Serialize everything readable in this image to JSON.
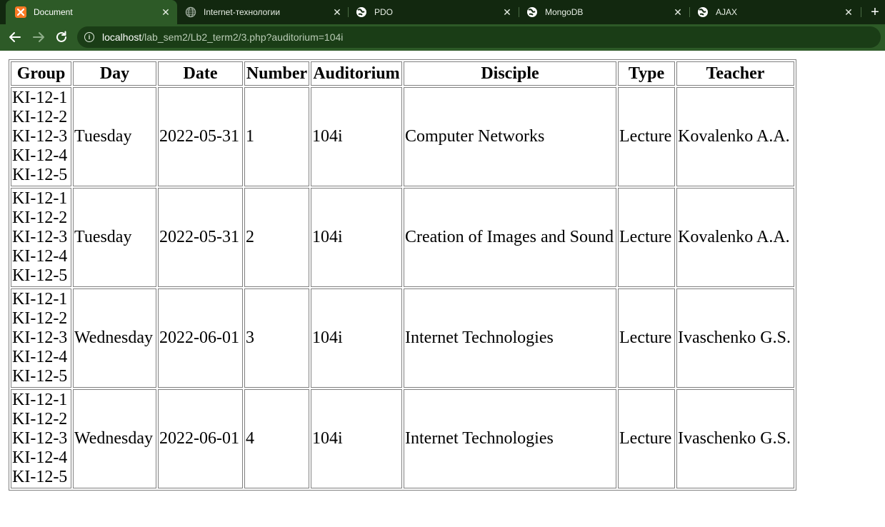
{
  "browser": {
    "tabs": [
      {
        "title": "Document",
        "icon": "xampp-icon",
        "active": true
      },
      {
        "title": "Internet-технологии",
        "icon": "globe-icon",
        "active": false
      },
      {
        "title": "PDO",
        "icon": "web-icon",
        "active": false
      },
      {
        "title": "MongoDB",
        "icon": "web-icon",
        "active": false
      },
      {
        "title": "AJAX",
        "icon": "web-icon",
        "active": false
      }
    ],
    "close_glyph": "✕",
    "new_tab_glyph": "+",
    "url_host": "localhost",
    "url_path": "/lab_sem2/Lb2_term2/3.php?auditorium=104i",
    "info_glyph": "i",
    "colors": {
      "tabbar": "#12280f",
      "active_tab": "#2d5a27",
      "toolbar": "#2d5a27",
      "omnibox": "#1a3d16"
    }
  },
  "table": {
    "headers": [
      "Group",
      "Day",
      "Date",
      "Number",
      "Auditorium",
      "Disciple",
      "Type",
      "Teacher"
    ],
    "rows": [
      {
        "groups": [
          "KI-12-1",
          "KI-12-2",
          "KI-12-3",
          "KI-12-4",
          "KI-12-5"
        ],
        "day": "Tuesday",
        "date": "2022-05-31",
        "number": "1",
        "auditorium": "104i",
        "disciple": "Computer Networks",
        "type": "Lecture",
        "teacher": "Kovalenko A.A."
      },
      {
        "groups": [
          "KI-12-1",
          "KI-12-2",
          "KI-12-3",
          "KI-12-4",
          "KI-12-5"
        ],
        "day": "Tuesday",
        "date": "2022-05-31",
        "number": "2",
        "auditorium": "104i",
        "disciple": "Creation of Images and Sound",
        "type": "Lecture",
        "teacher": "Kovalenko A.A."
      },
      {
        "groups": [
          "KI-12-1",
          "KI-12-2",
          "KI-12-3",
          "KI-12-4",
          "KI-12-5"
        ],
        "day": "Wednesday",
        "date": "2022-06-01",
        "number": "3",
        "auditorium": "104i",
        "disciple": "Internet Technologies",
        "type": "Lecture",
        "teacher": "Ivaschenko G.S."
      },
      {
        "groups": [
          "KI-12-1",
          "KI-12-2",
          "KI-12-3",
          "KI-12-4",
          "KI-12-5"
        ],
        "day": "Wednesday",
        "date": "2022-06-01",
        "number": "4",
        "auditorium": "104i",
        "disciple": "Internet Technologies",
        "type": "Lecture",
        "teacher": "Ivaschenko G.S."
      }
    ]
  }
}
